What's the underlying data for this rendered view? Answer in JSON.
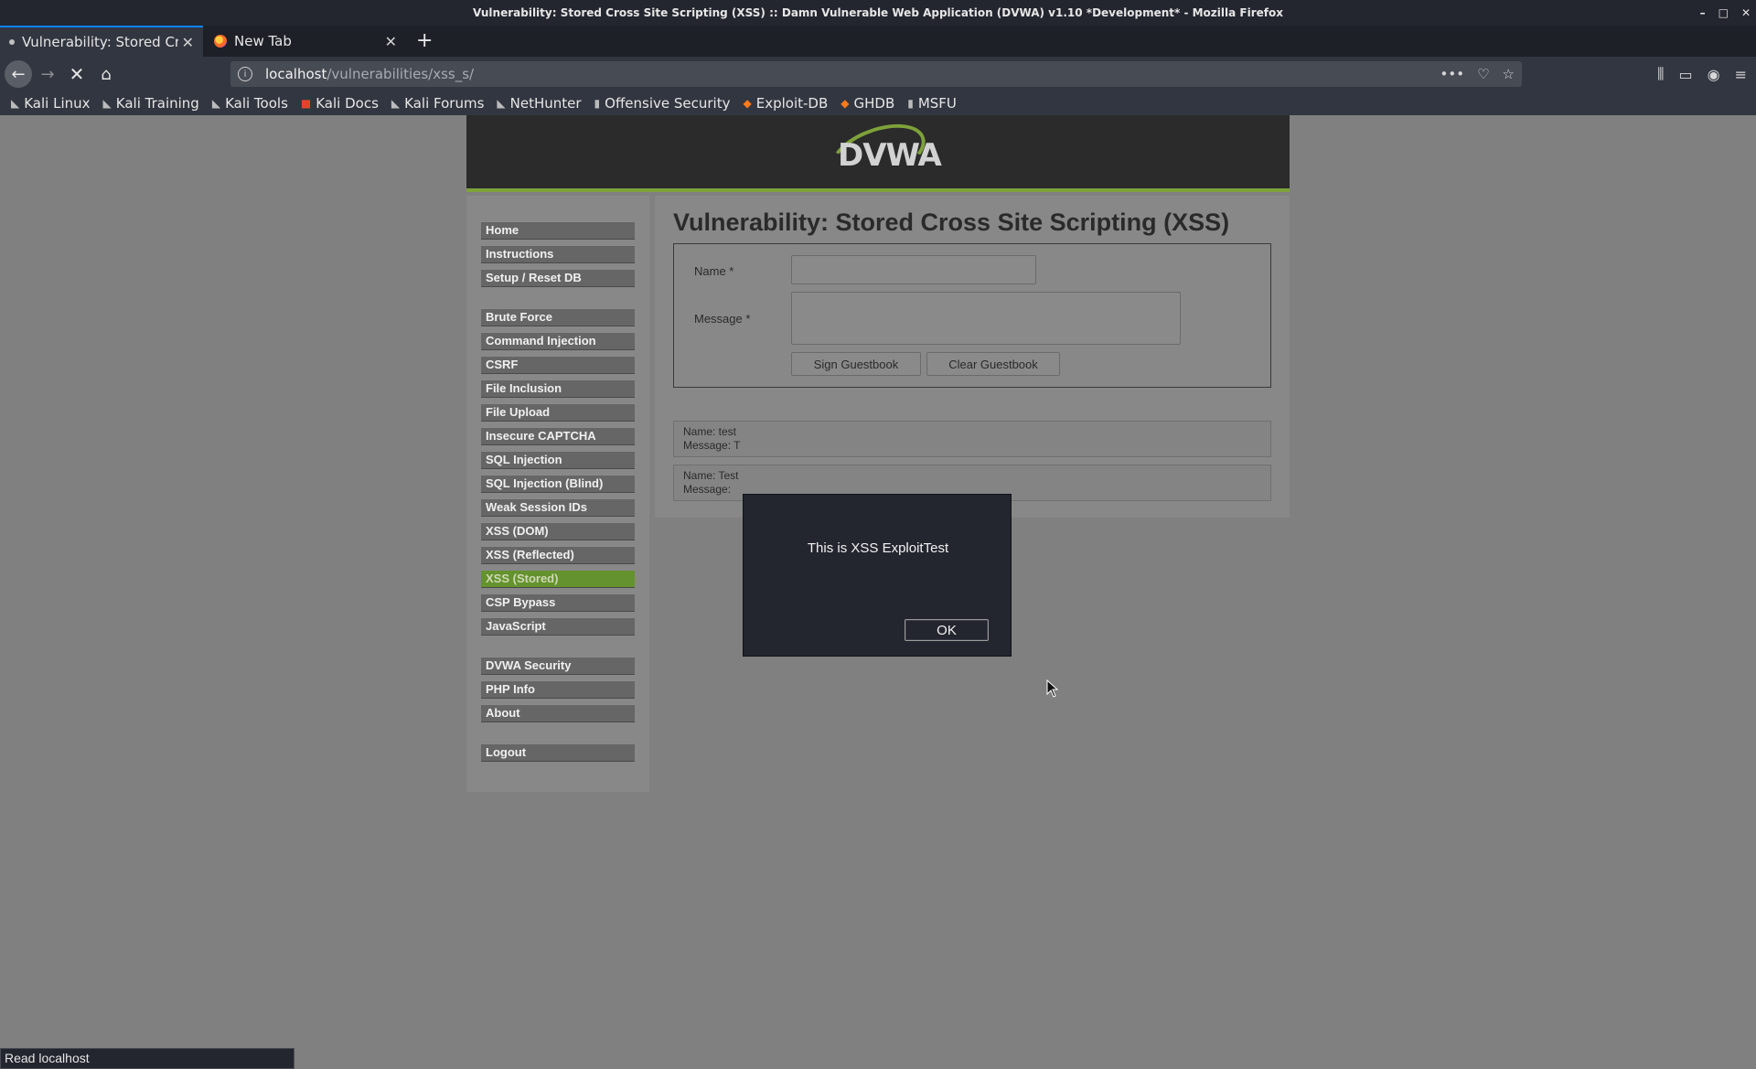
{
  "window": {
    "title": "Vulnerability: Stored Cross Site Scripting (XSS) :: Damn Vulnerable Web Application (DVWA) v1.10 *Development* - Mozilla Firefox",
    "controls": [
      "–",
      "□",
      "✕"
    ]
  },
  "tabs": [
    {
      "label": "Vulnerability: Stored Cro",
      "active": true,
      "close": "✕"
    },
    {
      "label": "New Tab",
      "active": false,
      "close": "✕"
    }
  ],
  "new_tab_glyph": "+",
  "nav": {
    "back": "←",
    "forward": "→",
    "stop": "✕",
    "home": "⌂",
    "url_host": "localhost",
    "url_path": "/vulnerabilities/xss_s/",
    "url_actions": [
      "•••",
      "♡",
      "☆"
    ],
    "toolbar_right": [
      "⫼",
      "▭",
      "◉",
      "≡"
    ]
  },
  "bookmarks": [
    {
      "label": "Kali Linux",
      "icon": "kali-dragon-icon"
    },
    {
      "label": "Kali Training",
      "icon": "kali-dragon-icon"
    },
    {
      "label": "Kali Tools",
      "icon": "kali-dragon-icon"
    },
    {
      "label": "Kali Docs",
      "icon": "kali-docs-icon"
    },
    {
      "label": "Kali Forums",
      "icon": "kali-dragon-icon"
    },
    {
      "label": "NetHunter",
      "icon": "nethunter-icon"
    },
    {
      "label": "Offensive Security",
      "icon": "offsec-icon"
    },
    {
      "label": "Exploit-DB",
      "icon": "exploitdb-icon"
    },
    {
      "label": "GHDB",
      "icon": "ghdb-icon"
    },
    {
      "label": "MSFU",
      "icon": "msfu-icon"
    }
  ],
  "dvwa": {
    "logo": "DVWA",
    "menu_group_1": [
      "Home",
      "Instructions",
      "Setup / Reset DB"
    ],
    "menu_group_2": [
      "Brute Force",
      "Command Injection",
      "CSRF",
      "File Inclusion",
      "File Upload",
      "Insecure CAPTCHA",
      "SQL Injection",
      "SQL Injection (Blind)",
      "Weak Session IDs",
      "XSS (DOM)",
      "XSS (Reflected)",
      "XSS (Stored)",
      "CSP Bypass",
      "JavaScript"
    ],
    "menu_group_3": [
      "DVWA Security",
      "PHP Info",
      "About"
    ],
    "menu_group_4": [
      "Logout"
    ],
    "selected_menu": "XSS (Stored)",
    "page_title": "Vulnerability: Stored Cross Site Scripting (XSS)",
    "form": {
      "name_label": "Name *",
      "message_label": "Message *",
      "name_value": "",
      "message_value": "",
      "sign_button": "Sign Guestbook",
      "clear_button": "Clear Guestbook"
    },
    "guestbook": [
      {
        "name_line": "Name: test",
        "message_line": "Message: T"
      },
      {
        "name_line": "Name: Test",
        "message_line": "Message:"
      }
    ]
  },
  "alert": {
    "text": "This is XSS ExploitTest",
    "ok": "OK"
  },
  "status": "Read localhost",
  "colors": {
    "accent_green": "#7ea23a",
    "selected_menu": "#64922e",
    "tab_accent": "#0a84ff"
  }
}
